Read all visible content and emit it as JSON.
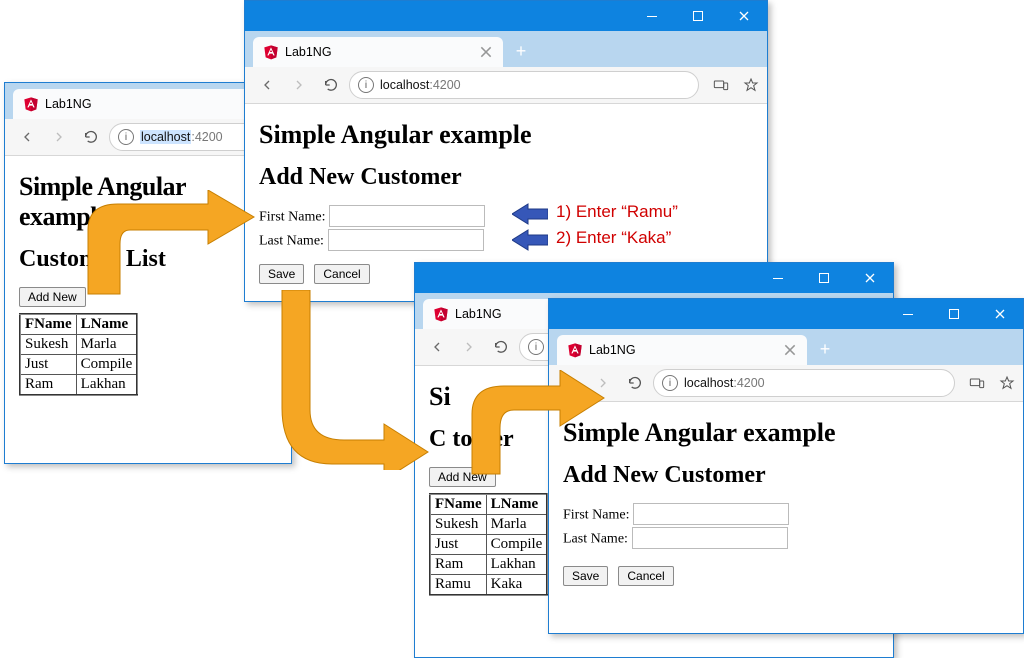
{
  "app": {
    "tabTitle": "Lab1NG",
    "urlHost": "localhost",
    "urlPort": ":4200",
    "newTab": "+"
  },
  "headings": {
    "main": "Simple Angular example",
    "list": "Customer List",
    "add": "Add New Customer"
  },
  "labels": {
    "addNew": "Add New",
    "firstName": "First Name:",
    "lastName": "Last Name:",
    "save": "Save",
    "cancel": "Cancel",
    "colF": "FName",
    "colL": "LName"
  },
  "table1": [
    {
      "f": "Sukesh",
      "l": "Marla"
    },
    {
      "f": "Just",
      "l": "Compile"
    },
    {
      "f": "Ram",
      "l": "Lakhan"
    }
  ],
  "table2": [
    {
      "f": "Sukesh",
      "l": "Marla"
    },
    {
      "f": "Just",
      "l": "Compile"
    },
    {
      "f": "Ram",
      "l": "Lakhan"
    },
    {
      "f": "Ramu",
      "l": "Kaka"
    }
  ],
  "annotations": {
    "step1": "1) Enter “Ramu”",
    "step2": "2) Enter “Kaka”"
  }
}
